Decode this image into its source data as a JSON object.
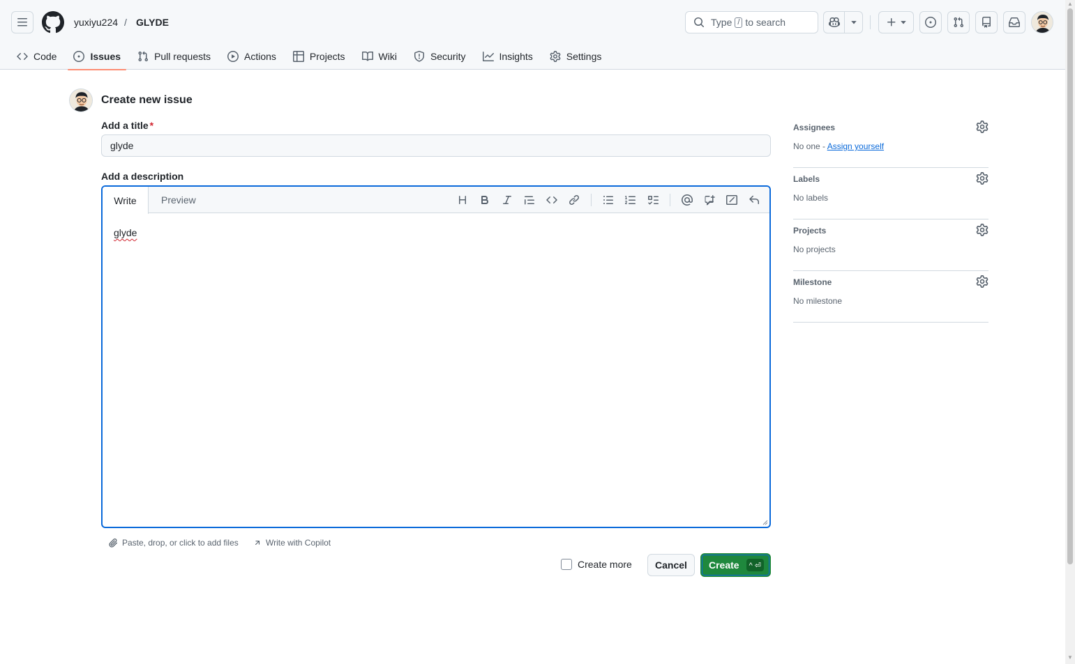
{
  "header": {
    "owner": "yuxiyu224",
    "separator": "/",
    "repo": "GLYDE",
    "search": {
      "prefix": "Type",
      "key": "/",
      "suffix": "to search"
    }
  },
  "tabs": [
    {
      "label": "Code",
      "icon": "code-icon",
      "active": false
    },
    {
      "label": "Issues",
      "icon": "issue-opened-icon",
      "active": true
    },
    {
      "label": "Pull requests",
      "icon": "git-pull-request-icon",
      "active": false
    },
    {
      "label": "Actions",
      "icon": "play-icon",
      "active": false
    },
    {
      "label": "Projects",
      "icon": "table-icon",
      "active": false
    },
    {
      "label": "Wiki",
      "icon": "book-icon",
      "active": false
    },
    {
      "label": "Security",
      "icon": "shield-icon",
      "active": false
    },
    {
      "label": "Insights",
      "icon": "graph-icon",
      "active": false
    },
    {
      "label": "Settings",
      "icon": "gear-icon",
      "active": false
    }
  ],
  "form": {
    "heading": "Create new issue",
    "title_label": "Add a title",
    "required_mark": "*",
    "title_value": "glyde",
    "description_label": "Add a description",
    "write_tab": "Write",
    "preview_tab": "Preview",
    "description_value": "glyde",
    "attach_hint": "Paste, drop, or click to add files",
    "copilot_hint": "Write with Copilot",
    "create_more_label": "Create more",
    "cancel_label": "Cancel",
    "create_label": "Create",
    "create_shortcut": "^ ⏎"
  },
  "toolbar_icons": [
    "heading-icon",
    "bold-icon",
    "italic-icon",
    "quote-icon",
    "code-icon",
    "link-icon",
    "unordered-list-icon",
    "ordered-list-icon",
    "task-list-icon",
    "mention-icon",
    "cross-reference-icon",
    "slash-command-icon",
    "undo-icon"
  ],
  "sidebar": {
    "assignees": {
      "title": "Assignees",
      "value": "No one -",
      "link": "Assign yourself"
    },
    "labels": {
      "title": "Labels",
      "value": "No labels"
    },
    "projects": {
      "title": "Projects",
      "value": "No projects"
    },
    "milestone": {
      "title": "Milestone",
      "value": "No milestone"
    }
  },
  "colors": {
    "accent": "#0969da",
    "create_button": "#1f883d",
    "active_tab_underline": "#fd8c73",
    "border": "#d1d9e0"
  }
}
